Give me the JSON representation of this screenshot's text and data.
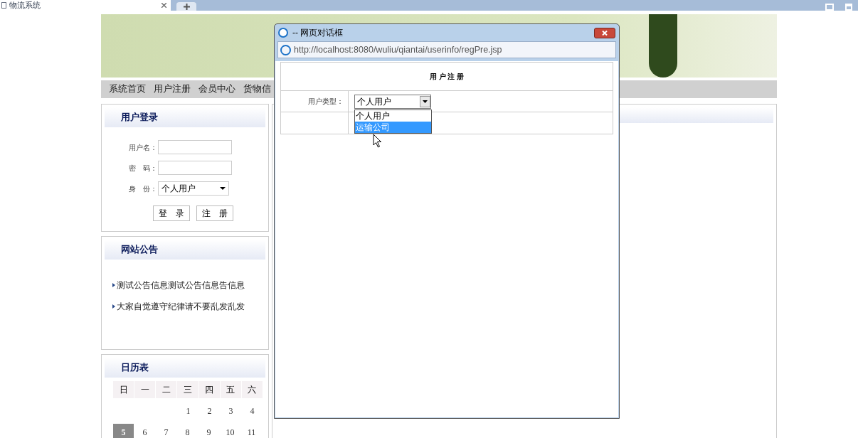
{
  "browser": {
    "tab_title": "物流系统"
  },
  "nav": {
    "items": [
      "系统首页",
      "用户注册",
      "会员中心",
      "货物信"
    ]
  },
  "login": {
    "title": "用户登录",
    "fields": [
      {
        "kind": "text",
        "label": "用户名："
      },
      {
        "kind": "text",
        "label": "密　码："
      },
      {
        "kind": "select",
        "label": "身　份：",
        "value": "个人用户"
      }
    ],
    "buttons": [
      "登　录",
      "注　册"
    ]
  },
  "notice": {
    "title": "网站公告",
    "items": [
      "测试公告信息测试公告信息告信息",
      "大家自觉遵守纪律请不要乱发乱发"
    ]
  },
  "calendar": {
    "title": "日历表",
    "weekdays": [
      "日",
      "一",
      "二",
      "三",
      "四",
      "五",
      "六"
    ],
    "weeks": [
      {
        "fill_from_end": true,
        "days": [
          {
            "day": "1",
            "selected": false
          },
          {
            "day": "2",
            "selected": false
          },
          {
            "day": "3",
            "selected": false
          },
          {
            "day": "4",
            "selected": false
          }
        ]
      },
      {
        "fill_from_end": false,
        "days": [
          {
            "day": "5",
            "selected": true
          },
          {
            "day": "6",
            "selected": false
          },
          {
            "day": "7",
            "selected": false
          },
          {
            "day": "8",
            "selected": false
          },
          {
            "day": "9",
            "selected": false
          },
          {
            "day": "10",
            "selected": false
          },
          {
            "day": "11",
            "selected": false
          }
        ]
      }
    ]
  },
  "dialog": {
    "title": "-- 网页对话框",
    "url": "http://localhost:8080/wuliu/qiantai/userinfo/regPre.jsp",
    "form_title": "用 户 注 册",
    "field_label": "用户类型：",
    "select_value": "个人用户",
    "options": [
      {
        "label": "个人用户",
        "selected": false
      },
      {
        "label": "运输公司",
        "selected": true
      }
    ]
  }
}
